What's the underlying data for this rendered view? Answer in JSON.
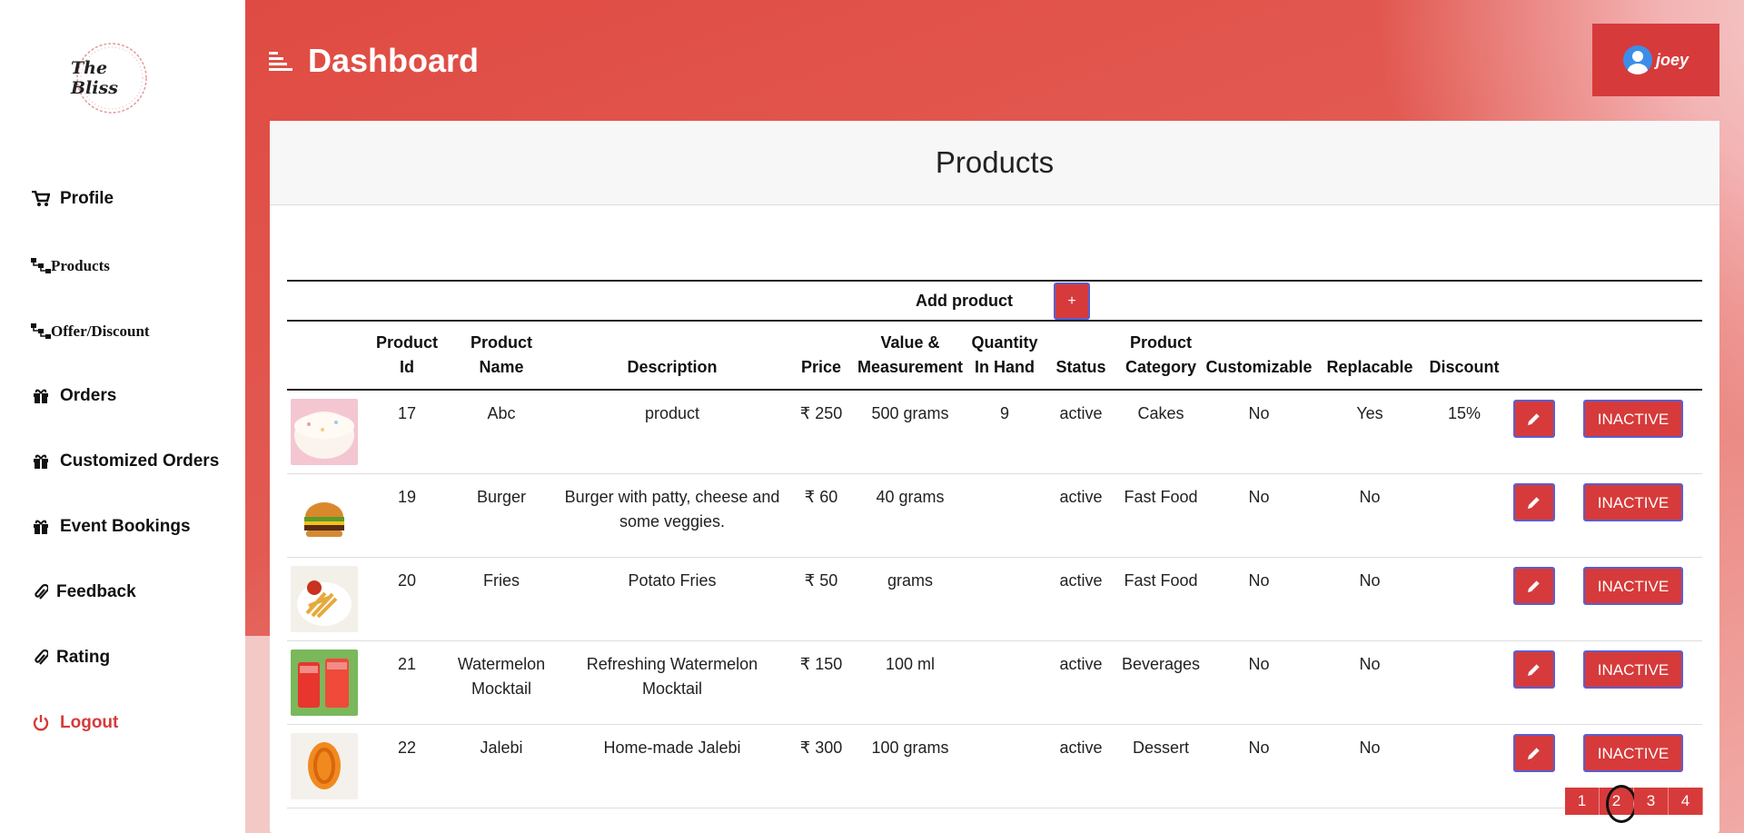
{
  "brand": {
    "logo_text": "The Bliss"
  },
  "sidebar": {
    "items": [
      {
        "label": "Profile",
        "icon": "cart-icon"
      },
      {
        "label": "Products",
        "icon": "sitemap-icon"
      },
      {
        "label": "Offer/Discount",
        "icon": "sitemap-icon"
      },
      {
        "label": "Orders",
        "icon": "gift-icon"
      },
      {
        "label": "Customized Orders",
        "icon": "gift-icon"
      },
      {
        "label": "Event Bookings",
        "icon": "gift-icon"
      },
      {
        "label": "Feedback",
        "icon": "paperclip-icon"
      },
      {
        "label": "Rating",
        "icon": "paperclip-icon"
      },
      {
        "label": "Logout",
        "icon": "power-icon"
      }
    ]
  },
  "header": {
    "title": "Dashboard",
    "user": "joey"
  },
  "card": {
    "title": "Products",
    "add_label": "Add product",
    "add_button": "+"
  },
  "table": {
    "headers": {
      "id": "Product Id",
      "name": "Product Name",
      "description": "Description",
      "price": "Price",
      "value": "Value & Measurement",
      "qty": "Quantity In Hand",
      "status": "Status",
      "category": "Product Category",
      "customizable": "Customizable",
      "replacable": "Replacable",
      "discount": "Discount"
    },
    "rows": [
      {
        "id": "17",
        "name": "Abc",
        "description": "product",
        "price": "₹ 250",
        "value": "500 grams",
        "qty": "9",
        "status": "active",
        "category": "Cakes",
        "customizable": "No",
        "replacable": "Yes",
        "discount": "15%",
        "action": "INACTIVE",
        "image": "cake"
      },
      {
        "id": "19",
        "name": "Burger",
        "description": "Burger with patty, cheese and some veggies.",
        "price": "₹ 60",
        "value": "40 grams",
        "qty": "",
        "status": "active",
        "category": "Fast Food",
        "customizable": "No",
        "replacable": "No",
        "discount": "",
        "action": "INACTIVE",
        "image": "burger"
      },
      {
        "id": "20",
        "name": "Fries",
        "description": "Potato Fries",
        "price": "₹ 50",
        "value": "grams",
        "qty": "",
        "status": "active",
        "category": "Fast Food",
        "customizable": "No",
        "replacable": "No",
        "discount": "",
        "action": "INACTIVE",
        "image": "fries"
      },
      {
        "id": "21",
        "name": "Watermelon Mocktail",
        "description": "Refreshing Watermelon Mocktail",
        "price": "₹ 150",
        "value": "100 ml",
        "qty": "",
        "status": "active",
        "category": "Beverages",
        "customizable": "No",
        "replacable": "No",
        "discount": "",
        "action": "INACTIVE",
        "image": "mocktail"
      },
      {
        "id": "22",
        "name": "Jalebi",
        "description": "Home-made Jalebi",
        "price": "₹ 300",
        "value": "100 grams",
        "qty": "",
        "status": "active",
        "category": "Dessert",
        "customizable": "No",
        "replacable": "No",
        "discount": "",
        "action": "INACTIVE",
        "image": "jalebi"
      }
    ]
  },
  "pagination": {
    "pages": [
      "1",
      "2",
      "3",
      "4"
    ],
    "current": "2"
  },
  "colors": {
    "accent": "#d73a3a",
    "button_border": "#5a5fd0",
    "logout": "#d63b3b"
  }
}
